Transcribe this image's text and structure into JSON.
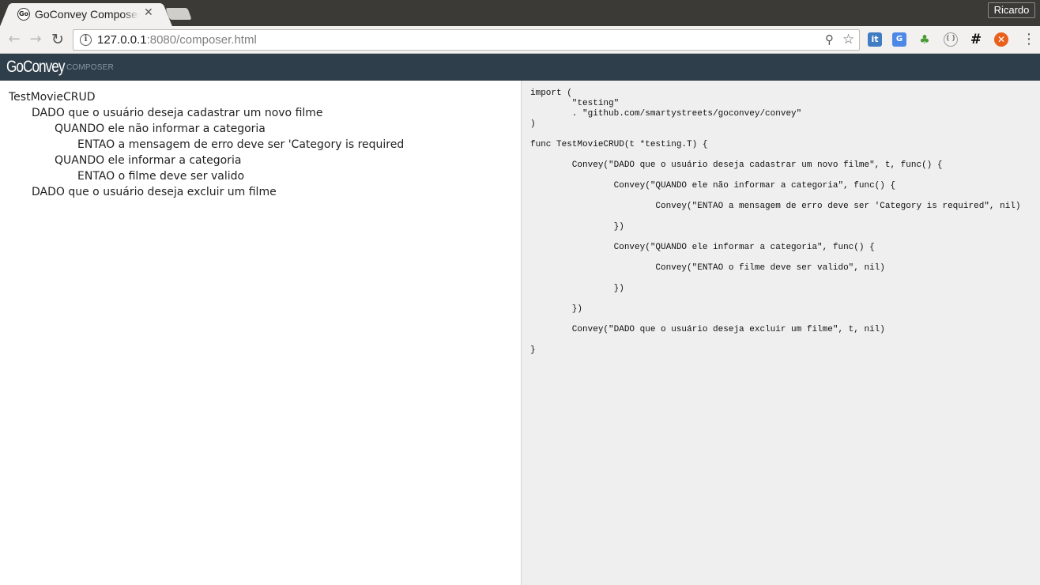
{
  "browser": {
    "tab_title": "GoConvey Composer",
    "tab_favicon_text": "Go",
    "profile_name": "Ricardo",
    "url_host": "127.0.0.1",
    "url_rest": ":8080/composer.html"
  },
  "app": {
    "brand": "GoConvey",
    "subtitle": "COMPOSER"
  },
  "tree": [
    "TestMovieCRUD",
    "DADO que o usuário deseja cadastrar um novo filme",
    "QUANDO ele não informar a categoria",
    "ENTAO a mensagem de erro deve ser 'Category is required",
    "QUANDO ele informar a categoria",
    "ENTAO o filme deve ser valido",
    "DADO que o usuário deseja excluir um filme"
  ],
  "code": [
    "import (",
    "        \"testing\"",
    "        . \"github.com/smartystreets/goconvey/convey\"",
    ")",
    "func TestMovieCRUD(t *testing.T) {",
    "        Convey(\"DADO que o usuário deseja cadastrar um novo filme\", t, func() {",
    "                Convey(\"QUANDO ele não informar a categoria\", func() {",
    "                        Convey(\"ENTAO a mensagem de erro deve ser 'Category is required\", nil)",
    "                })",
    "                Convey(\"QUANDO ele informar a categoria\", func() {",
    "                        Convey(\"ENTAO o filme deve ser valido\", nil)",
    "                })",
    "        })",
    "        Convey(\"DADO que o usuário deseja excluir um filme\", t, nil)",
    "}"
  ]
}
